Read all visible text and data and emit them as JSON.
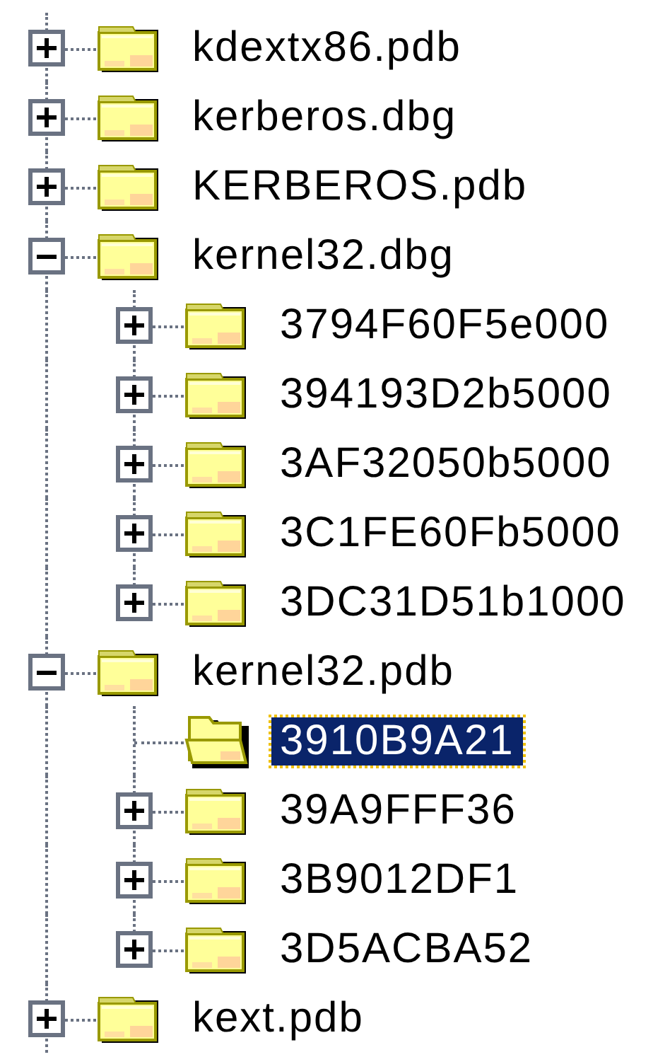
{
  "tree": [
    {
      "label": "kdextx86.pdb",
      "expanded": false,
      "selected": false
    },
    {
      "label": "kerberos.dbg",
      "expanded": false,
      "selected": false
    },
    {
      "label": "KERBEROS.pdb",
      "expanded": false,
      "selected": false
    },
    {
      "label": "kernel32.dbg",
      "expanded": true,
      "selected": false,
      "children": [
        {
          "label": "3794F60F5e000",
          "expanded": false,
          "selected": false
        },
        {
          "label": "394193D2b5000",
          "expanded": false,
          "selected": false
        },
        {
          "label": "3AF32050b5000",
          "expanded": false,
          "selected": false
        },
        {
          "label": "3C1FE60Fb5000",
          "expanded": false,
          "selected": false
        },
        {
          "label": "3DC31D51b1000",
          "expanded": false,
          "selected": false
        }
      ]
    },
    {
      "label": "kernel32.pdb",
      "expanded": true,
      "selected": false,
      "children": [
        {
          "label": "3910B9A21",
          "selected": true
        },
        {
          "label": "39A9FFF36",
          "expanded": false,
          "selected": false
        },
        {
          "label": "3B9012DF1",
          "expanded": false,
          "selected": false
        },
        {
          "label": "3D5ACBA52",
          "expanded": false,
          "selected": false
        }
      ]
    },
    {
      "label": "kext.pdb",
      "expanded": false,
      "selected": false
    }
  ]
}
